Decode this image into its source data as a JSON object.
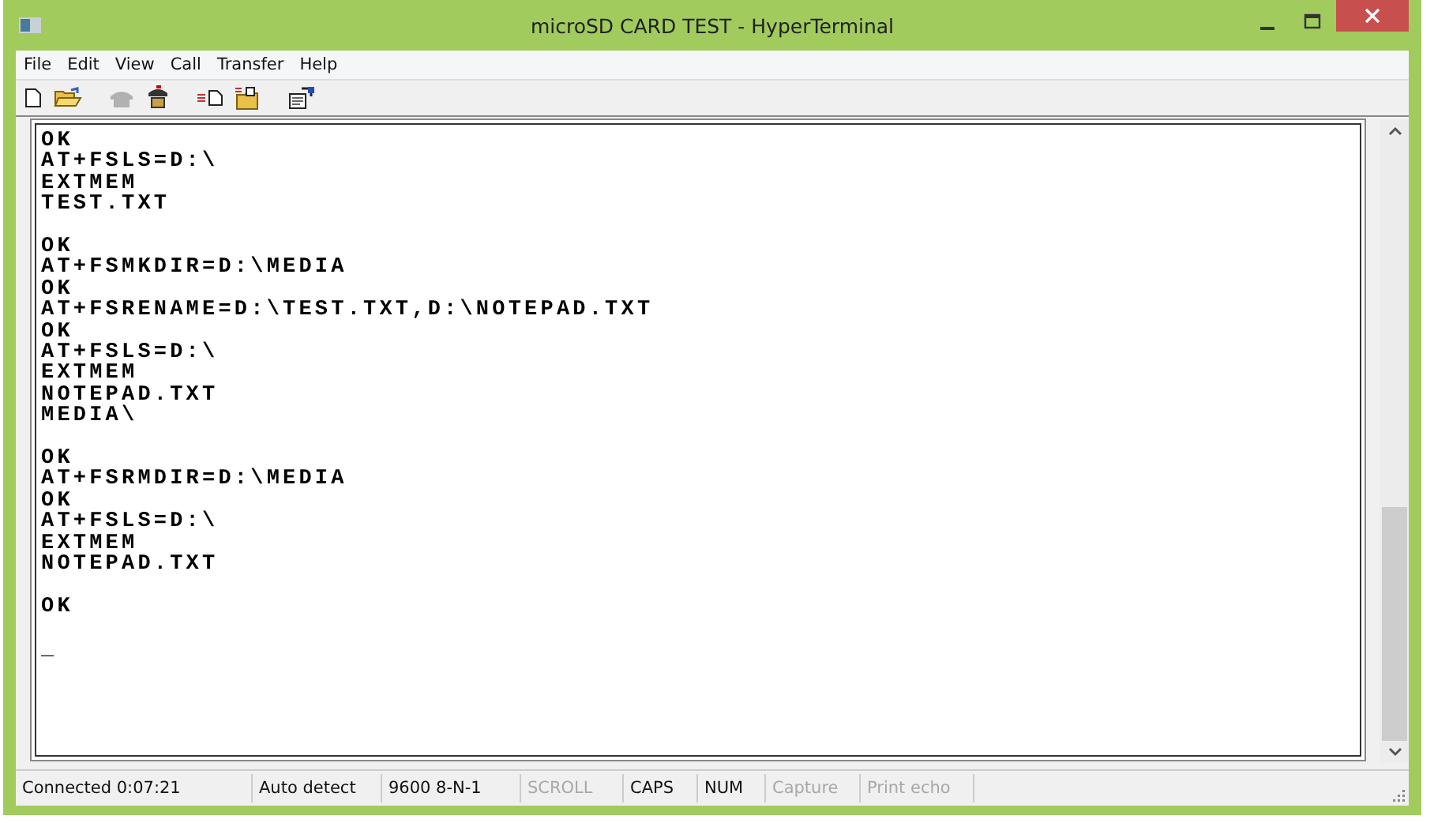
{
  "window": {
    "title": "microSD CARD TEST - HyperTerminal"
  },
  "menu": [
    "File",
    "Edit",
    "View",
    "Call",
    "Transfer",
    "Help"
  ],
  "toolbar": [
    {
      "kind": "new",
      "disabled": false
    },
    {
      "kind": "open",
      "disabled": false
    },
    {
      "kind": "disconnect",
      "disabled": true
    },
    {
      "kind": "dial",
      "disabled": false
    },
    {
      "kind": "send",
      "disabled": false
    },
    {
      "kind": "receive",
      "disabled": false
    },
    {
      "kind": "properties",
      "disabled": false
    }
  ],
  "terminal": {
    "blocks": [
      [
        "OK",
        "AT+FSLS=D:\\",
        "EXTMEM",
        "TEST.TXT"
      ],
      [
        "OK",
        "AT+FSMKDIR=D:\\MEDIA",
        "OK",
        "AT+FSRENAME=D:\\TEST.TXT,D:\\NOTEPAD.TXT",
        "OK",
        "AT+FSLS=D:\\",
        "EXTMEM",
        "NOTEPAD.TXT",
        "MEDIA\\"
      ],
      [
        "OK",
        "AT+FSRMDIR=D:\\MEDIA",
        "OK",
        "AT+FSLS=D:\\",
        "EXTMEM",
        "NOTEPAD.TXT"
      ],
      [
        "OK"
      ],
      [
        "_"
      ]
    ]
  },
  "status_bar": [
    {
      "text": "Connected 0:07:21",
      "disabled": false
    },
    {
      "text": "Auto detect",
      "disabled": false
    },
    {
      "text": "9600 8-N-1",
      "disabled": false
    },
    {
      "text": "SCROLL",
      "disabled": true
    },
    {
      "text": "CAPS",
      "disabled": false
    },
    {
      "text": "NUM",
      "disabled": false
    },
    {
      "text": "Capture",
      "disabled": true
    },
    {
      "text": "Print echo",
      "disabled": true
    }
  ]
}
